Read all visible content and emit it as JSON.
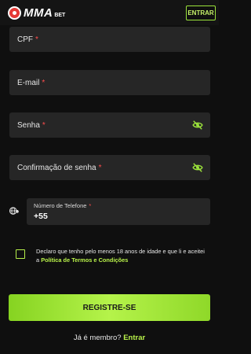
{
  "header": {
    "logo_text": "MMA",
    "logo_sub": "BET",
    "enter_label": "ENTRAR"
  },
  "form": {
    "cpf_label": "CPF",
    "email_label": "E-mail",
    "password_label": "Senha",
    "password_confirm_label": "Confirmação de senha",
    "required_mark": "*",
    "phone": {
      "label": "Número de Telefone",
      "value": "+55"
    },
    "terms": {
      "text": "Declaro que tenho pelo menos 18 anos de idade e que li e aceitei a",
      "link": "Política de Termos e Condições"
    },
    "register_label": "REGISTRE-SE"
  },
  "footer": {
    "member_question": "Já é membro?",
    "login_link": "Entrar"
  },
  "colors": {
    "accent": "#b5f34a",
    "background": "#0f0f0f",
    "field": "#262626",
    "required": "#ff4d4d"
  },
  "icons": [
    "eye-off-icon",
    "phone-icon",
    "logo-icon"
  ]
}
